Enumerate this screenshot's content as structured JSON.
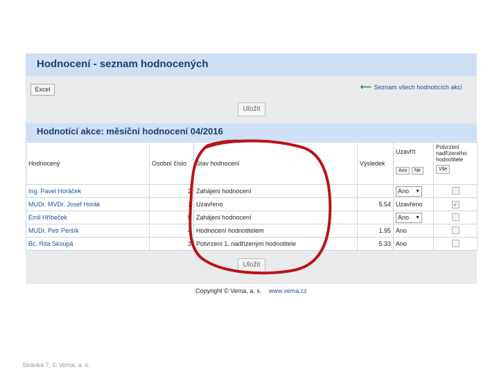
{
  "header": {
    "title": "Hodnocení - seznam hodnocených"
  },
  "toolbar": {
    "excel_label": "Excel",
    "all_actions_link": "Seznam všech hodnotících akcí",
    "save_label": "Uložit"
  },
  "action": {
    "title": "Hodnotící akce: měsíční hodnocení 04/2016"
  },
  "table": {
    "headers": {
      "name": "Hodnocený",
      "personal_no": "Osobní číslo",
      "status": "Stav hodnocení",
      "result": "Výsledek",
      "rate": "Uzavřít",
      "confirm": "Potvrzení nadřízeného hodnotitele"
    },
    "sub_buttons": {
      "yes": "Ano",
      "no": "Ne",
      "all": "Vše"
    },
    "rows": [
      {
        "name": "Ing. Pavel Horáček",
        "no": "2",
        "status": "Zahájení hodnocení",
        "result": "",
        "rate": "Ano",
        "rate_select": true,
        "checked": false
      },
      {
        "name": "MUDr. MVDr. Josef Horák",
        "no": "1",
        "status": "Uzavřeno",
        "result": "5.54",
        "rate": "Uzavřeno",
        "rate_select": false,
        "checked": true
      },
      {
        "name": "Emil Hříbeček",
        "no": "5",
        "status": "Zahájení hodnocení",
        "result": "",
        "rate": "Ano",
        "rate_select": true,
        "checked": false
      },
      {
        "name": "MUDr. Petr Peršík",
        "no": "4",
        "status": "Hodnocení hodnotitelem",
        "result": "1.95",
        "rate": "Ano",
        "rate_select": false,
        "checked": false
      },
      {
        "name": "Bc. Rita Skoupá",
        "no": "3",
        "status": "Potvrzení 1. nadřízeným hodnotitele",
        "result": "5.33",
        "rate": "Ano",
        "rate_select": false,
        "checked": false
      }
    ]
  },
  "footer": {
    "copyright": "Copyright © Vema, a. s.",
    "link": "www.vema.cz"
  },
  "slide_footer": "Stránka 7, © Vema, a. s.",
  "colors": {
    "header_bg": "#cfe0f5",
    "accent": "#1b3f73",
    "annotation": "#b81417"
  }
}
